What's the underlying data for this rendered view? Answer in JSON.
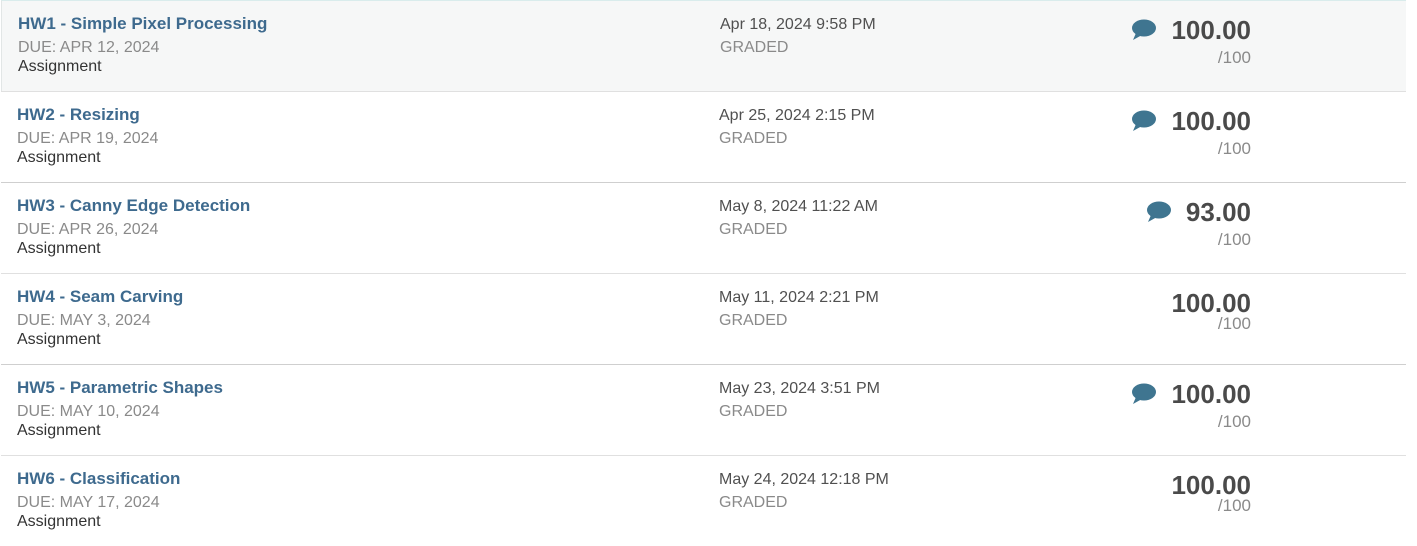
{
  "assignments": [
    {
      "title": "HW1 - Simple Pixel Processing",
      "due": "DUE: APR 12, 2024",
      "kind": "Assignment",
      "submitted": "Apr 18, 2024 9:58 PM",
      "status": "GRADED",
      "score": "100.00",
      "out_of": "/100",
      "has_feedback": true
    },
    {
      "title": "HW2 - Resizing",
      "due": "DUE: APR 19, 2024",
      "kind": "Assignment",
      "submitted": "Apr 25, 2024 2:15 PM",
      "status": "GRADED",
      "score": "100.00",
      "out_of": "/100",
      "has_feedback": true
    },
    {
      "title": "HW3 - Canny Edge Detection",
      "due": "DUE: APR 26, 2024",
      "kind": "Assignment",
      "submitted": "May 8, 2024 11:22 AM",
      "status": "GRADED",
      "score": "93.00",
      "out_of": "/100",
      "has_feedback": true
    },
    {
      "title": "HW4 - Seam Carving",
      "due": "DUE: MAY 3, 2024",
      "kind": "Assignment",
      "submitted": "May 11, 2024 2:21 PM",
      "status": "GRADED",
      "score": "100.00",
      "out_of": "/100",
      "has_feedback": false
    },
    {
      "title": "HW5 - Parametric Shapes",
      "due": "DUE: MAY 10, 2024",
      "kind": "Assignment",
      "submitted": "May 23, 2024 3:51 PM",
      "status": "GRADED",
      "score": "100.00",
      "out_of": "/100",
      "has_feedback": true
    },
    {
      "title": "HW6 - Classification",
      "due": "DUE: MAY 17, 2024",
      "kind": "Assignment",
      "submitted": "May 24, 2024 12:18 PM",
      "status": "GRADED",
      "score": "100.00",
      "out_of": "/100",
      "has_feedback": false
    }
  ],
  "colors": {
    "title_link": "#3e6a8e",
    "comment_icon": "#3f7590",
    "score": "#4a4a4a",
    "muted": "#8a8a8a"
  },
  "icons": {
    "feedback": "comment-bubble-icon"
  }
}
